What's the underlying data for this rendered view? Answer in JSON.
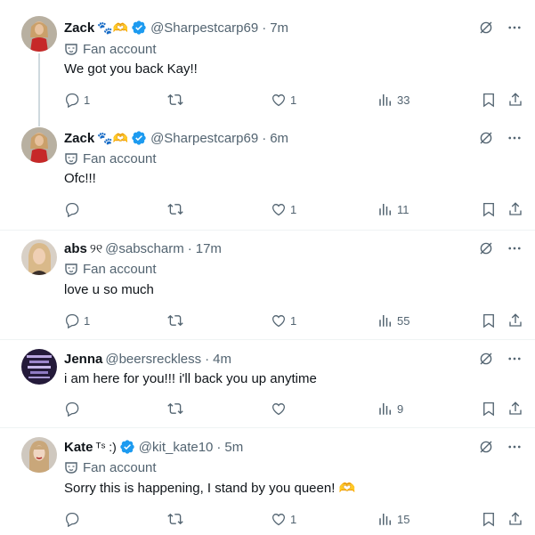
{
  "colors": {
    "text": "#0f1419",
    "secondary": "#536471",
    "verified": "#1d9bf0",
    "divider": "#eff3f4",
    "thread": "#cfd9de"
  },
  "posts": [
    {
      "name": "Zack",
      "name_emoji": "🐾🫶",
      "verified": true,
      "handle": "@Sharpestcarp69",
      "time": "7m",
      "label": "Fan account",
      "text": "We got you back Kay!!",
      "replies": "1",
      "retweets": "",
      "likes": "1",
      "views": "33"
    },
    {
      "name": "Zack",
      "name_emoji": "🐾🫶",
      "verified": true,
      "handle": "@Sharpestcarp69",
      "time": "6m",
      "label": "Fan account",
      "text": "Ofc!!!",
      "replies": "",
      "retweets": "",
      "likes": "1",
      "views": "11"
    },
    {
      "name": "abs",
      "name_emoji": "୨୧",
      "verified": false,
      "handle": "@sabscharm",
      "time": "17m",
      "label": "Fan account",
      "text": "love u so much",
      "replies": "1",
      "retweets": "",
      "likes": "1",
      "views": "55"
    },
    {
      "name": "Jenna",
      "name_emoji": "",
      "verified": false,
      "handle": "@beersreckless",
      "time": "4m",
      "label": "",
      "text": "i am here for you!!! i'll back you up anytime",
      "replies": "",
      "retweets": "",
      "likes": "",
      "views": "9"
    },
    {
      "name": "Kate",
      "name_emoji": "ᵀˢ :)",
      "verified": true,
      "handle": "@kit_kate10",
      "time": "5m",
      "label": "Fan account",
      "text": "Sorry this is happening, I stand by you queen! 🫶",
      "replies": "",
      "retweets": "",
      "likes": "1",
      "views": "15"
    }
  ]
}
